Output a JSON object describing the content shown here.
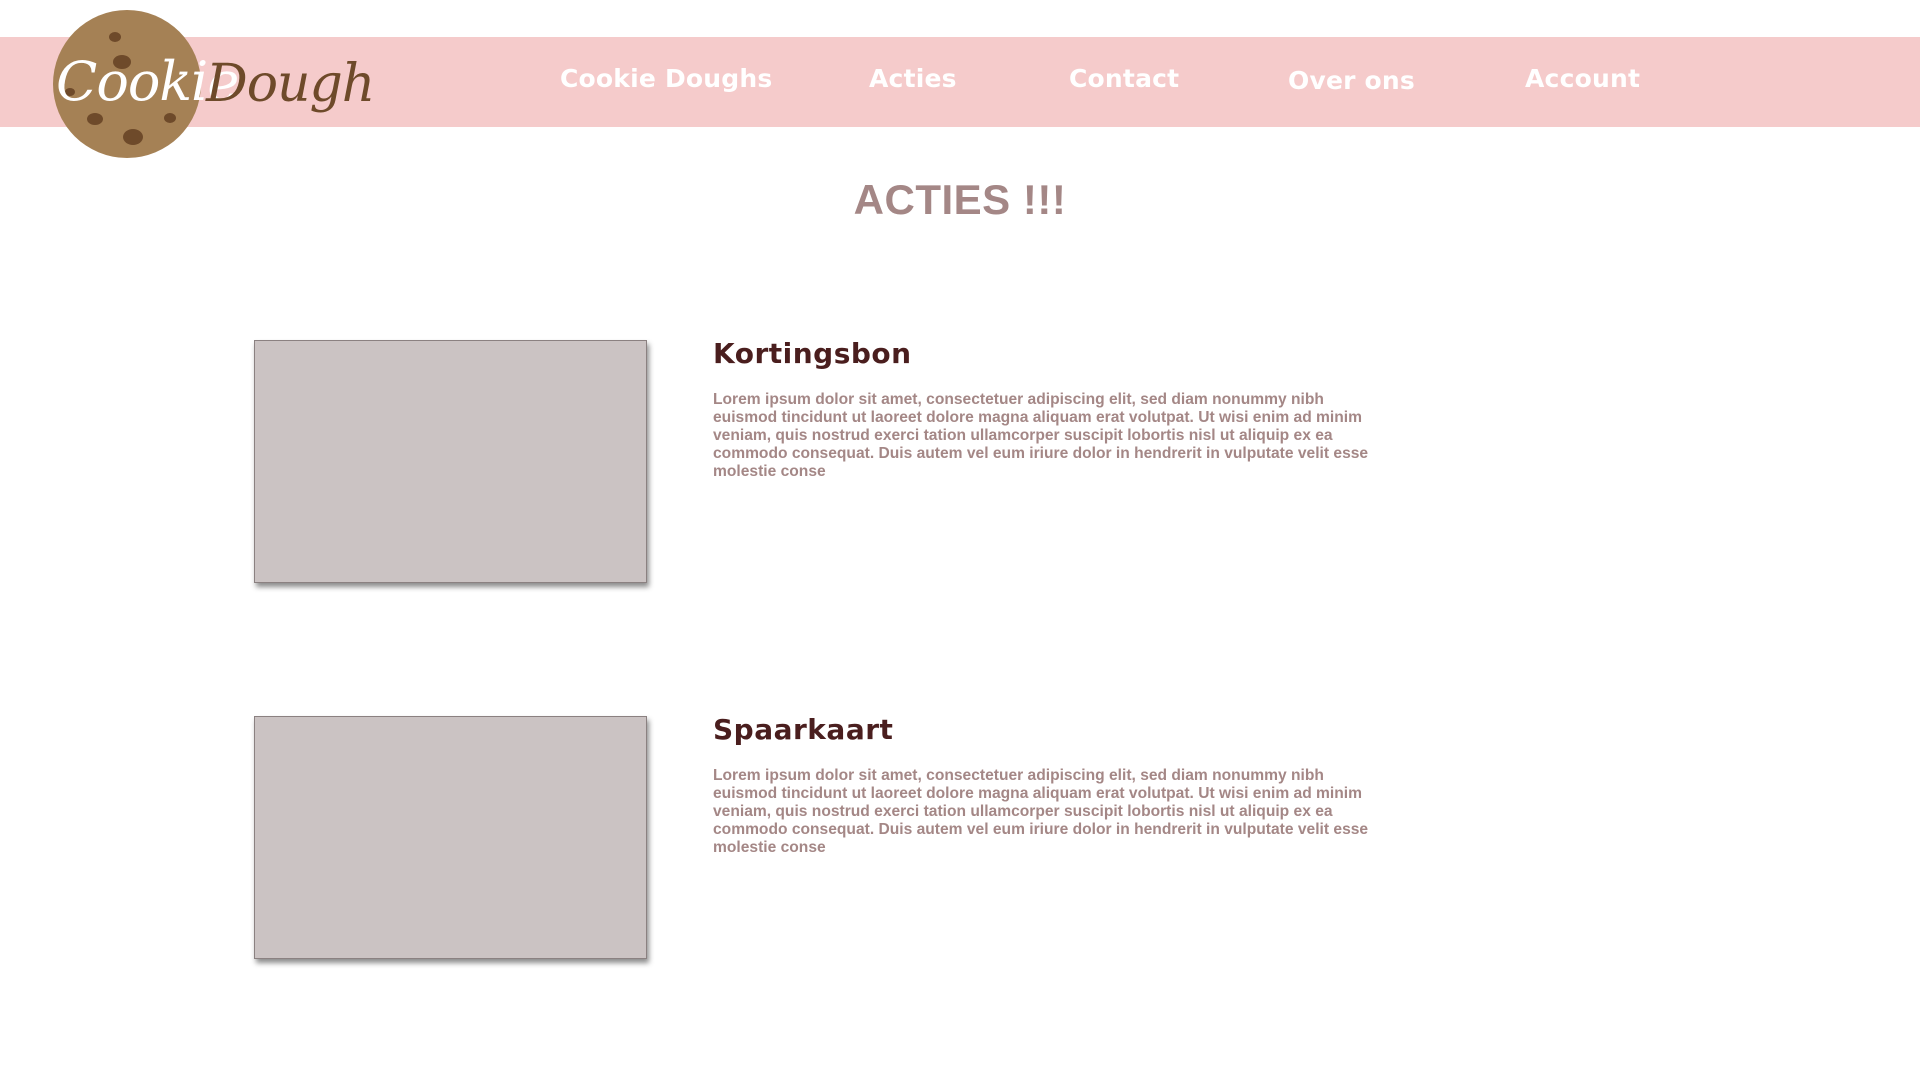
{
  "logo": {
    "word_1": "Cookie",
    "word_2": "Dough"
  },
  "nav": {
    "items": [
      {
        "label": "Cookie Doughs"
      },
      {
        "label": "Acties"
      },
      {
        "label": "Contact"
      },
      {
        "label": "Over ons"
      },
      {
        "label": "Account"
      }
    ]
  },
  "main": {
    "title": "ACTIES !!!",
    "promos": [
      {
        "title": "Kortingsbon",
        "text": "Lorem ipsum dolor sit amet, consectetuer adipiscing elit, sed diam nonummy nibh euismod tincidunt ut laoreet dolore magna aliquam erat volutpat. Ut wisi enim ad minim veniam, quis nostrud exerci tation ullamcorper suscipit lobortis nisl ut aliquip ex ea commodo consequat. Duis autem vel eum iriure dolor in hendrerit in vulputate velit esse molestie conse"
      },
      {
        "title": "Spaarkaart",
        "text": "Lorem ipsum dolor sit amet, consectetuer adipiscing elit, sed diam nonummy nibh euismod tincidunt ut laoreet dolore magna aliquam erat volutpat. Ut wisi enim ad minim veniam, quis nostrud exerci tation ullamcorper suscipit lobortis nisl ut aliquip ex ea commodo consequat. Duis autem vel eum iriure dolor in hendrerit in vulputate velit esse molestie conse"
      }
    ]
  },
  "colors": {
    "nav_background": "#f5cbcb",
    "nav_text": "#ffffff",
    "title_text": "#a48786",
    "heading_text": "#4a1e1e",
    "image_placeholder": "#cbc3c3",
    "cookie": "#a58155",
    "cookie_chips": "#6e4a2a"
  },
  "icons": {
    "logo_cookie": "cookie-icon"
  }
}
